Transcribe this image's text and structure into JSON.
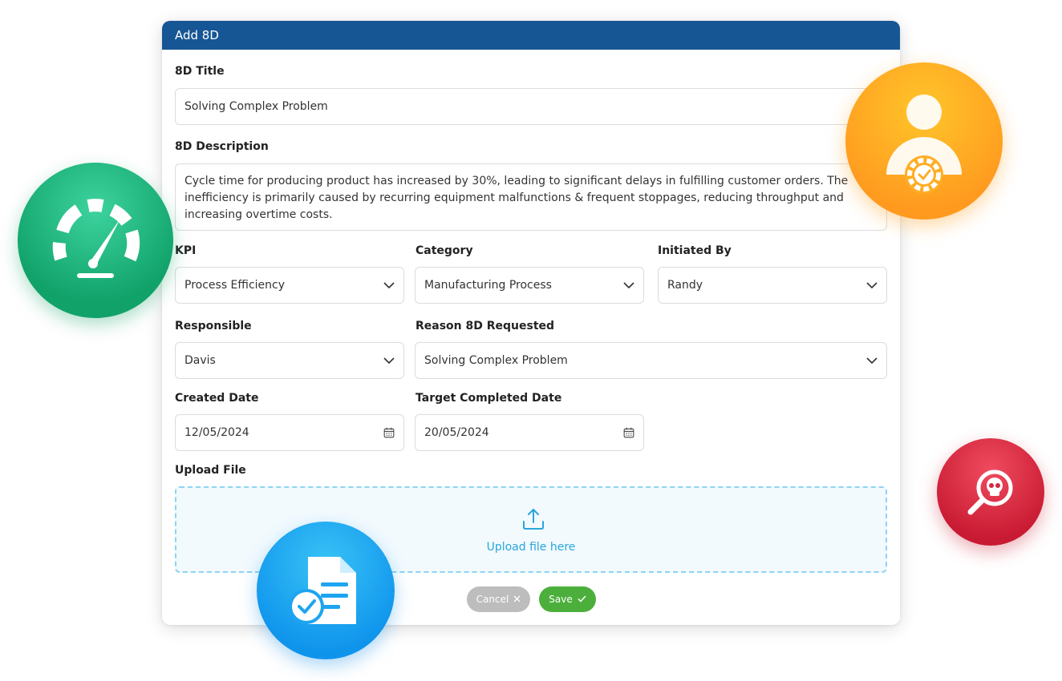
{
  "dialog": {
    "title": "Add 8D"
  },
  "form": {
    "title_label": "8D Title",
    "title_value": "Solving Complex Problem",
    "description_label": "8D Description",
    "description_value": "Cycle time for producing product has increased by 30%, leading to significant delays in fulfilling customer orders. The inefficiency is primarily caused by recurring equipment malfunctions & frequent stoppages, reducing throughput and increasing overtime costs.",
    "kpi_label": "KPI",
    "kpi_value": "Process Efficiency",
    "category_label": "Category",
    "category_value": "Manufacturing Process",
    "initiated_label": "Initiated By",
    "initiated_value": "Randy",
    "responsible_label": "Responsible",
    "responsible_value": "Davis",
    "reason_label": "Reason 8D Requested",
    "reason_value": "Solving Complex Problem",
    "created_label": "Created Date",
    "created_value": "12/05/2024",
    "target_label": "Target Completed Date",
    "target_value": "20/05/2024",
    "upload_label": "Upload File",
    "upload_text": "Upload file here"
  },
  "actions": {
    "cancel_label": "Cancel",
    "save_label": "Save"
  },
  "decorations": {
    "icons": [
      "speedometer-icon",
      "user-gear-icon",
      "skull-search-icon",
      "document-check-icon"
    ]
  },
  "colors": {
    "header": "#175694",
    "save": "#4caf3c",
    "cancel": "#bdbdbd",
    "upload_accent": "#2aa5dc"
  }
}
